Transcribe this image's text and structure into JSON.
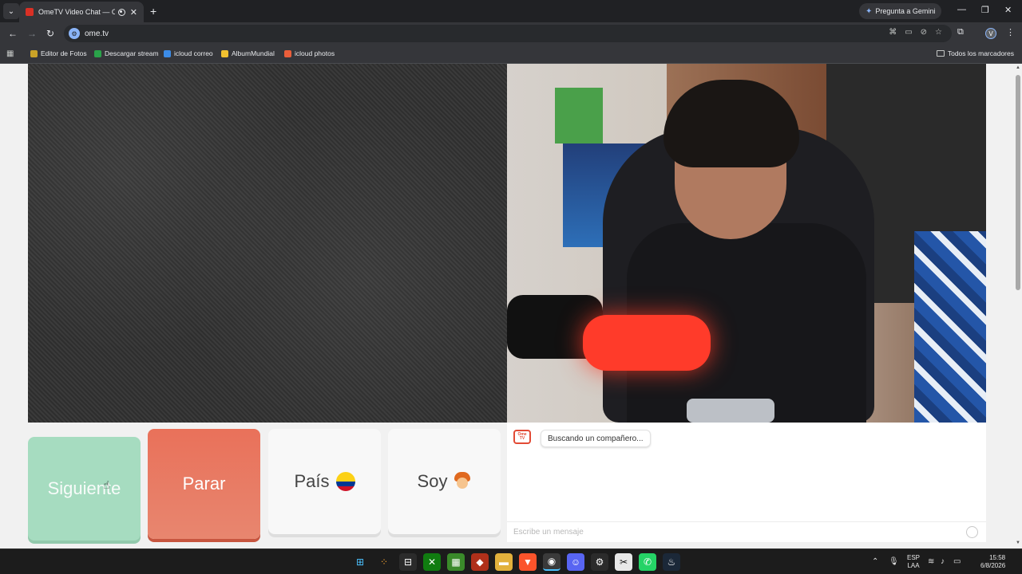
{
  "browser": {
    "tab": {
      "title": "OmeTV Video Chat — Ome",
      "close_glyph": "✕"
    },
    "new_tab_glyph": "+",
    "gemini_label": "Pregunta a Gemini",
    "url": "ome.tv",
    "window": {
      "minimize": "—",
      "maximize": "❐",
      "close": "✕"
    },
    "avatar_letter": "V",
    "bookmarks": [
      {
        "label": "Editor de Fotos",
        "color": "#c9a227"
      },
      {
        "label": "Descargar stream",
        "color": "#2aa34a"
      },
      {
        "label": "icloud correo",
        "color": "#3c8ce7"
      },
      {
        "label": "AlbumMundial",
        "color": "#f2c230"
      },
      {
        "label": "icloud photos",
        "color": "#ea5e3a"
      }
    ],
    "all_bookmarks": "Todos los marcadores"
  },
  "controls": {
    "next_label": "Siguiente",
    "stop_label": "Parar",
    "country_label": "País",
    "me_label": "Soy"
  },
  "chat": {
    "status_message": "Buscando un compañero...",
    "logo_line1": "Ome",
    "logo_line2": "TV",
    "input_placeholder": "Escribe un mensaje"
  },
  "taskbar": {
    "language_top": "ESP",
    "language_bottom": "LAA",
    "time": "15:58",
    "date": "6/8/2026"
  }
}
